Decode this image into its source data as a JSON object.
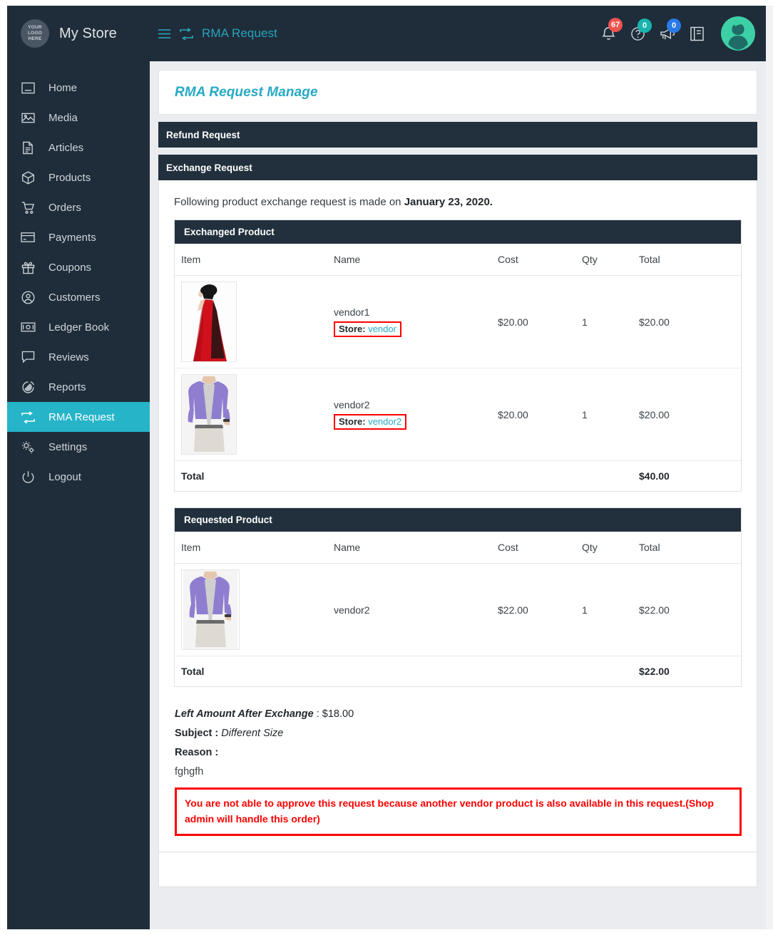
{
  "topbar": {
    "logo_text_lines": [
      "YOUR",
      "LOGO",
      "HERE"
    ],
    "brand": "My Store",
    "menu_icon": "hamburger-icon",
    "breadcrumb_icon": "rma-exchange-icon",
    "breadcrumb": "RMA Request",
    "notifications": {
      "icon": "bell-icon",
      "count": "67"
    },
    "help": {
      "icon": "question-circle-icon",
      "count": "0"
    },
    "announcements": {
      "icon": "megaphone-icon",
      "count": "0"
    },
    "docs": {
      "icon": "book-icon"
    },
    "avatar": {
      "icon": "user-avatar-icon"
    }
  },
  "sidebar": {
    "items": [
      {
        "label": "Home",
        "icon": "dashboard-icon",
        "active": false
      },
      {
        "label": "Media",
        "icon": "image-icon",
        "active": false
      },
      {
        "label": "Articles",
        "icon": "document-icon",
        "active": false
      },
      {
        "label": "Products",
        "icon": "box-icon",
        "active": false
      },
      {
        "label": "Orders",
        "icon": "cart-icon",
        "active": false
      },
      {
        "label": "Payments",
        "icon": "credit-card-icon",
        "active": false
      },
      {
        "label": "Coupons",
        "icon": "gift-icon",
        "active": false
      },
      {
        "label": "Customers",
        "icon": "user-circle-icon",
        "active": false
      },
      {
        "label": "Ledger Book",
        "icon": "money-icon",
        "active": false
      },
      {
        "label": "Reviews",
        "icon": "comment-icon",
        "active": false
      },
      {
        "label": "Reports",
        "icon": "pie-chart-icon",
        "active": false
      },
      {
        "label": "RMA Request",
        "icon": "rma-exchange-icon",
        "active": true
      },
      {
        "label": "Settings",
        "icon": "gears-icon",
        "active": false
      },
      {
        "label": "Logout",
        "icon": "power-icon",
        "active": false
      }
    ]
  },
  "main": {
    "page_title": "RMA Request Manage",
    "refund_panel_title": "Refund Request",
    "exchange_panel_title": "Exchange Request",
    "intro_prefix": "Following product exchange request is made on ",
    "intro_date": "January 23, 2020.",
    "exchanged": {
      "section_title": "Exchanged Product",
      "columns": [
        "Item",
        "Name",
        "Cost",
        "Qty",
        "Total"
      ],
      "rows": [
        {
          "thumb": "red-gown-product-image",
          "name": "vendor1",
          "store_label": "Store:",
          "store_value": "vendor",
          "cost": "$20.00",
          "qty": "1",
          "total": "$20.00"
        },
        {
          "thumb": "purple-shirt-product-image",
          "name": "vendor2",
          "store_label": "Store:",
          "store_value": "vendor2",
          "cost": "$20.00",
          "qty": "1",
          "total": "$20.00"
        }
      ],
      "total_label": "Total",
      "total_value": "$40.00"
    },
    "requested": {
      "section_title": "Requested Product",
      "columns": [
        "Item",
        "Name",
        "Cost",
        "Qty",
        "Total"
      ],
      "rows": [
        {
          "thumb": "purple-shirt-product-image",
          "name": "vendor2",
          "cost": "$22.00",
          "qty": "1",
          "total": "$22.00"
        }
      ],
      "total_label": "Total",
      "total_value": "$22.00"
    },
    "details": {
      "left_amount_label": "Left Amount After Exchange",
      "left_amount_value": ": $18.00",
      "subject_label": "Subject :",
      "subject_value": "Different Size",
      "reason_label": "Reason :",
      "reason_value": "fghgfh",
      "alert_message": "You are not able to approve this request because another vendor product is also available in this request.(Shop admin will handle this order)"
    }
  },
  "colors": {
    "sidebar_bg": "#1f2d3a",
    "accent_teal": "#26b4c8",
    "title_teal": "#26a9c4",
    "panel_dark": "#22303d",
    "alert_red": "#ff0000",
    "badge_red": "#ef5350",
    "badge_teal": "#18b5ae",
    "badge_blue": "#2979e8",
    "page_bg": "#eaecef"
  }
}
